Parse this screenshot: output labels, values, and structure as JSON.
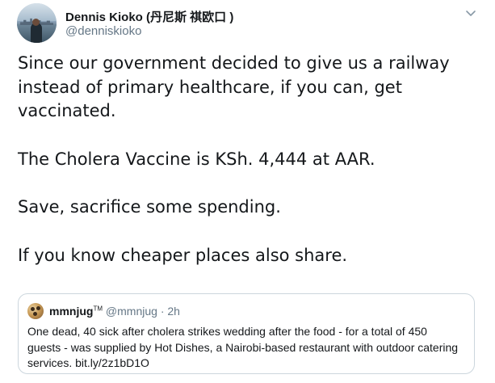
{
  "author": {
    "display_name": "Dennis Kioko (丹尼斯 祺欧口 )",
    "handle": "@denniskioko"
  },
  "tweet": {
    "paragraphs": [
      "Since our government decided to give us a railway instead of primary healthcare, if you can, get vaccinated.",
      "The Cholera Vaccine is KSh. 4,444 at AAR.",
      "Save, sacrifice some spending.",
      "If you know cheaper places also share."
    ]
  },
  "quoted_tweet": {
    "display_name": "mmnjug",
    "trademark": "TM",
    "handle": "@mmnjug",
    "separator": "·",
    "time": "2h",
    "text": "One dead, 40 sick after cholera strikes wedding after the food - for a total of 450 guests - was supplied by Hot Dishes, a Nairobi-based restaurant with outdoor catering services.  bit.ly/2z1bD1O"
  },
  "icons": {
    "more": "chevron-down-icon",
    "avatar": "user-avatar",
    "quoted_avatar": "quoted-user-avatar"
  },
  "colors": {
    "text": "#14171a",
    "secondary_text": "#657786",
    "border": "#ccd6dd"
  }
}
